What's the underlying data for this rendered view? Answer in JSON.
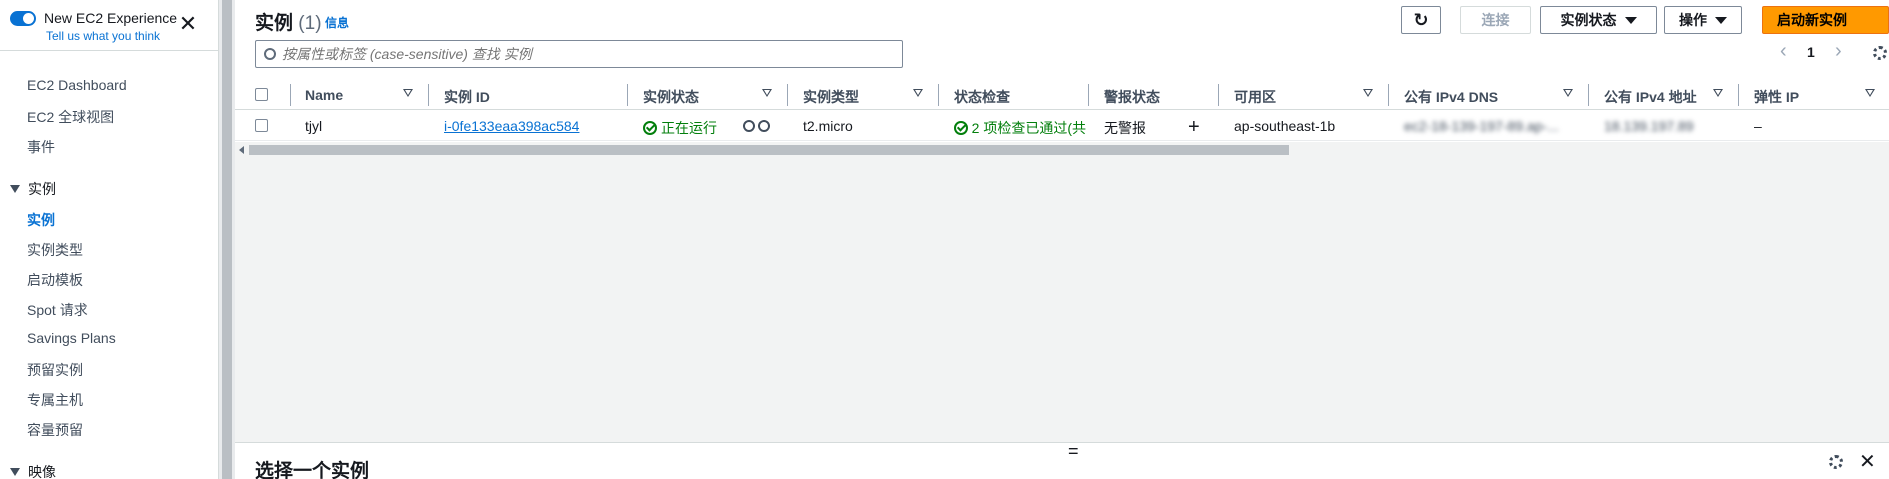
{
  "sidebar": {
    "toggle_title": "New EC2 Experience",
    "toggle_link": "Tell us what you think",
    "close_glyph": "✕",
    "items_top": [
      "EC2 Dashboard",
      "EC2 全球视图",
      "事件"
    ],
    "section_instances": "实例",
    "instances_items": [
      "实例",
      "实例类型",
      "启动模板",
      "Spot 请求",
      "Savings Plans",
      "预留实例",
      "专属主机",
      "容量预留"
    ],
    "section_images": "映像"
  },
  "header": {
    "title": "实例",
    "count": "(1)",
    "info": "信息",
    "buttons": {
      "refresh_glyph": "↻",
      "connect": "连接",
      "instance_state": "实例状态",
      "actions": "操作",
      "launch": "启动新实例"
    }
  },
  "search": {
    "placeholder": "按属性或标签 (case-sensitive) 查找 实例"
  },
  "pager": {
    "prev": "‹",
    "page": "1",
    "next": "›"
  },
  "table": {
    "columns": [
      "Name",
      "实例 ID",
      "实例状态",
      "实例类型",
      "状态检查",
      "警报状态",
      "可用区",
      "公有 IPv4 DNS",
      "公有 IPv4 地址",
      "弹性 IP"
    ],
    "row": {
      "name": "tjyl",
      "id": "i-0fe133eaa398ac584",
      "state": "正在运行",
      "type": "t2.micro",
      "check": "2 项检查已通过(共",
      "alarm": "无警报",
      "az": "ap-southeast-1b",
      "dns": "ec2-18-139-197-89.ap-...",
      "ip": "18.139.197.89",
      "eip": "–"
    }
  },
  "split": {
    "handle": "=",
    "title": "选择一个实例"
  },
  "colors": {
    "accent": "#0972d3",
    "primary": "#ff9900",
    "ok": "#037f0c"
  }
}
